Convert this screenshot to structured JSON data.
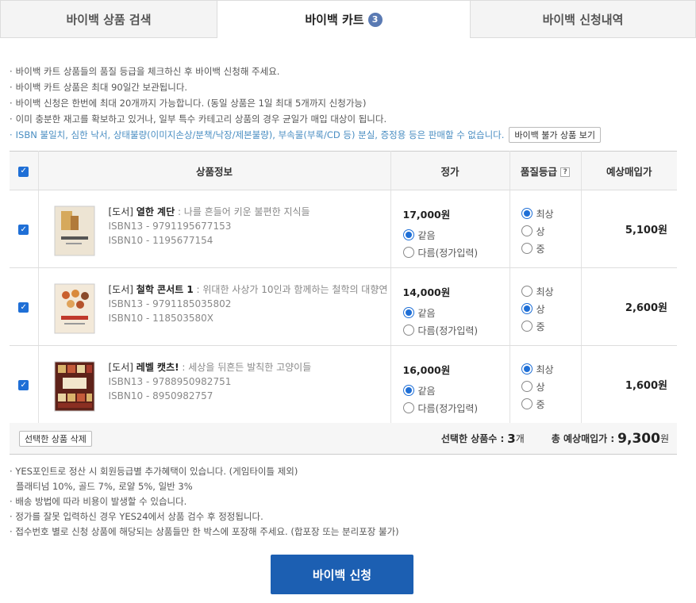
{
  "tabs": [
    {
      "label": "바이백 상품 검색"
    },
    {
      "label": "바이백 카트",
      "badge": "3"
    },
    {
      "label": "바이백 신청내역"
    }
  ],
  "notices": [
    "바이백 카트 상품들의 품질 등급을 체크하신 후 바이백 신청해 주세요.",
    "바이백 카트 상품은 최대 90일간 보관됩니다.",
    "바이백 신청은 한번에 최대 20개까지 가능합니다. (동일 상품은 1일 최대 5개까지 신청가능)",
    "이미 충분한 재고를 확보하고 있거나, 일부 특수 카테고리 상품의 경우 균일가 매입 대상이 됩니다.",
    "ISBN 불일치, 심한 낙서, 상태불량(이미지손상/분책/낙장/제본불량), 부속물(부록/CD 등) 분실, 증정용 등은 판매할 수 없습니다."
  ],
  "notice_button": "바이백 불가 상품 보기",
  "table": {
    "headers": {
      "info": "상품정보",
      "price": "정가",
      "grade": "품질등급",
      "grade_help": "?",
      "buy": "예상매입가"
    },
    "rows": [
      {
        "category": "[도서]",
        "title": "열한 계단",
        "subtitle": " : 나를 흔들어 키운 불편한 지식들",
        "isbn13": "ISBN13 - 9791195677153",
        "isbn10": "ISBN10 - 1195677154",
        "price": "17,000원",
        "price_opt1": "같음",
        "price_opt2": "다름(정가입력)",
        "grade_opts": [
          "최상",
          "상",
          "중"
        ],
        "grade_selected": 0,
        "buy_price": "5,100원",
        "cover_color": "#e8dcc7"
      },
      {
        "category": "[도서]",
        "title": "철학 콘서트 1",
        "subtitle": " : 위대한 사상가 10인과 함께하는 철학의 대향연",
        "isbn13": "ISBN13 - 9791185035802",
        "isbn10": "ISBN10 - 118503580X",
        "price": "14,000원",
        "price_opt1": "같음",
        "price_opt2": "다름(정가입력)",
        "grade_opts": [
          "최상",
          "상",
          "중"
        ],
        "grade_selected": 1,
        "buy_price": "2,600원",
        "cover_color": "#f1e6d6"
      },
      {
        "category": "[도서]",
        "title": "레벨 캣츠!",
        "subtitle": " : 세상을 뒤흔든 발칙한 고양이들",
        "isbn13": "ISBN13 - 9788950982751",
        "isbn10": "ISBN10 - 8950982757",
        "price": "16,000원",
        "price_opt1": "같음",
        "price_opt2": "다름(정가입력)",
        "grade_opts": [
          "최상",
          "상",
          "중"
        ],
        "grade_selected": 0,
        "buy_price": "1,600원",
        "cover_color": "#6b2a20"
      }
    ]
  },
  "footer": {
    "delete_button": "선택한 상품 삭제",
    "selected_label": "선택한 상품수 :",
    "selected_count": "3",
    "selected_unit": "개",
    "total_label": "총 예상매입가 :",
    "total_value": "9,300",
    "total_unit": "원"
  },
  "notes": [
    "YES포인트로 정산 시 회원등급별 추가혜택이 있습니다. (게임타이틀 제외)",
    "플래티넘 10%, 골드 7%, 로얄 5%, 일반 3%",
    "배송 방법에 따라 비용이 발생할 수 있습니다.",
    "정가를 잘못 입력하신 경우 YES24에서 상품 검수 후 정정됩니다.",
    "접수번호 별로 신청 상품에 해당되는 상품들만 한 박스에 포장해 주세요. (합포장 또는 분리포장 불가)"
  ],
  "submit_label": "바이백 신청",
  "colors": {
    "accent": "#1c5fb2",
    "checkbox": "#1f6fd6",
    "notice_blue": "#4a8ec2"
  }
}
